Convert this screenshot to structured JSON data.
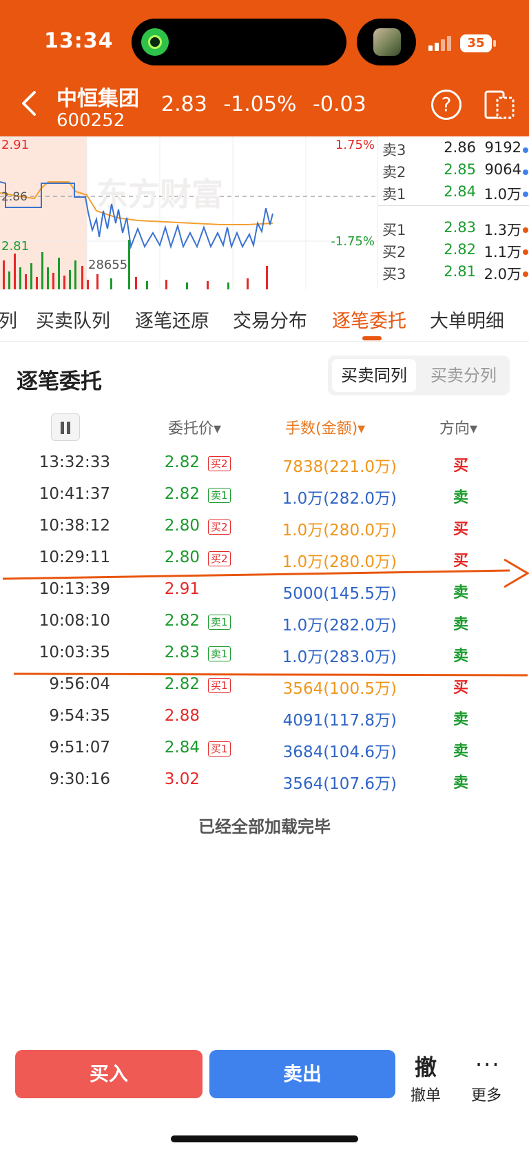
{
  "status_bar": {
    "time": "13:34",
    "battery": "35"
  },
  "header": {
    "name": "中恒集团",
    "code": "600252",
    "price": "2.83",
    "change_pct": "-1.05%",
    "change": "-0.03",
    "help_icon": "?"
  },
  "chart": {
    "high_price": "2.91",
    "mid_price": "2.86",
    "low_price": "2.81",
    "up_pct": "1.75%",
    "down_pct": "-1.75%",
    "volume_label": "28655",
    "watermark": "东方财富"
  },
  "order_book": {
    "asks": [
      {
        "label": "卖3",
        "price": "2.86",
        "vol": "9192"
      },
      {
        "label": "卖2",
        "price": "2.85",
        "vol": "9064"
      },
      {
        "label": "卖1",
        "price": "2.84",
        "vol": "1.0万"
      }
    ],
    "bids": [
      {
        "label": "买1",
        "price": "2.83",
        "vol": "1.3万"
      },
      {
        "label": "买2",
        "price": "2.82",
        "vol": "1.1万"
      },
      {
        "label": "买3",
        "price": "2.81",
        "vol": "2.0万"
      }
    ]
  },
  "tabs": [
    "列",
    "买卖队列",
    "逐笔还原",
    "交易分布",
    "逐笔委托",
    "大单明细"
  ],
  "section": {
    "title": "逐笔委托",
    "seg_same": "买卖同列",
    "seg_split": "买卖分列"
  },
  "columns": {
    "price": "委托价▾",
    "volume": "手数(金额)▾",
    "direction": "方向▾"
  },
  "orders": [
    {
      "time": "13:32:33",
      "price": "2.82",
      "badge": "买2",
      "volume": "7838(221.0万)",
      "direction": "买"
    },
    {
      "time": "10:41:37",
      "price": "2.82",
      "badge": "卖1",
      "volume": "1.0万(282.0万)",
      "direction": "卖"
    },
    {
      "time": "10:38:12",
      "price": "2.80",
      "badge": "买2",
      "volume": "1.0万(280.0万)",
      "direction": "买"
    },
    {
      "time": "10:29:11",
      "price": "2.80",
      "badge": "买2",
      "volume": "1.0万(280.0万)",
      "direction": "买"
    },
    {
      "time": "10:13:39",
      "price": "2.91",
      "badge": "",
      "volume": "5000(145.5万)",
      "direction": "卖"
    },
    {
      "time": "10:08:10",
      "price": "2.82",
      "badge": "卖1",
      "volume": "1.0万(282.0万)",
      "direction": "卖"
    },
    {
      "time": "10:03:35",
      "price": "2.83",
      "badge": "卖1",
      "volume": "1.0万(283.0万)",
      "direction": "卖"
    },
    {
      "time": "9:56:04",
      "price": "2.82",
      "badge": "买1",
      "volume": "3564(100.5万)",
      "direction": "买"
    },
    {
      "time": "9:54:35",
      "price": "2.88",
      "badge": "",
      "volume": "4091(117.8万)",
      "direction": "卖"
    },
    {
      "time": "9:51:07",
      "price": "2.84",
      "badge": "买1",
      "volume": "3684(104.6万)",
      "direction": "卖"
    },
    {
      "time": "9:30:16",
      "price": "3.02",
      "badge": "",
      "volume": "3564(107.6万)",
      "direction": "卖"
    }
  ],
  "loaded_text": "已经全部加载完毕",
  "bottom": {
    "buy": "买入",
    "sell": "卖出",
    "cancel_icon": "撤",
    "cancel": "撤单",
    "more_icon": "···",
    "more": "更多"
  },
  "colors": {
    "brand": "#e8560f",
    "up": "#e62828",
    "down": "#1a9b2d",
    "sell_blue": "#2f64c6",
    "buy_orange": "#f0961a"
  }
}
